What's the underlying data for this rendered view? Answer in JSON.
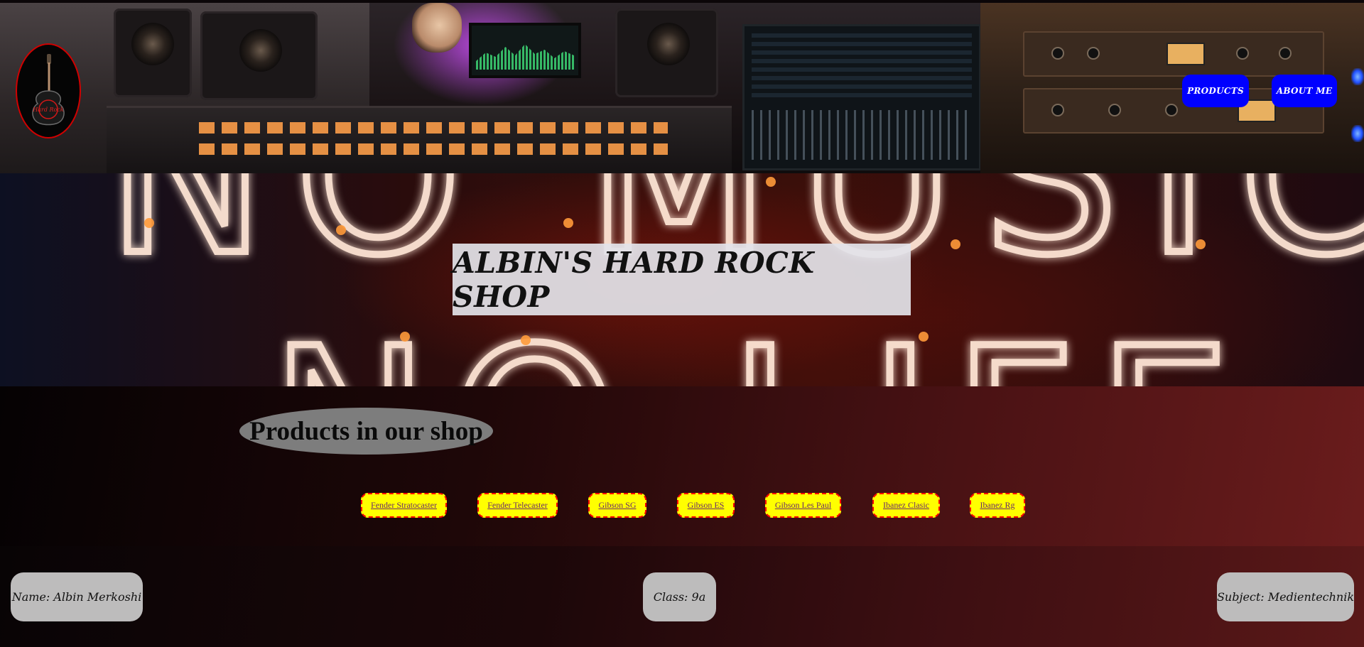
{
  "header": {
    "logo_icon": "hard-rock-guitar-logo",
    "logo_text": "Hard Rock",
    "nav": [
      {
        "label": "PRODUCTS"
      },
      {
        "label": "ABOUT ME"
      }
    ]
  },
  "hero": {
    "title": "ALBIN'S HARD ROCK SHOP",
    "background_text_line1": "NO MUSIC",
    "background_text_line2": "NO LIFE"
  },
  "products": {
    "heading": "Products in our shop",
    "links": [
      {
        "label": "Fender Stratocaster"
      },
      {
        "label": "Fender Telecaster"
      },
      {
        "label": "Gibson SG"
      },
      {
        "label": "Gibson ES"
      },
      {
        "label": "Gibson Les Paul"
      },
      {
        "label": "Ibanez Clasic"
      },
      {
        "label": "Ibanez Rg"
      }
    ]
  },
  "footer": {
    "name": "Name: Albin Merkoshi",
    "class": "Class: 9a",
    "subject": "Subject: Medientechnik"
  },
  "colors": {
    "nav_button": "#0000ff",
    "product_link_bg": "#ffff00",
    "product_link_border": "#ff0000",
    "neon": "#ffd9c2",
    "heading_pill": "#7d7d7d",
    "footer_box": "#bdbcbc"
  }
}
